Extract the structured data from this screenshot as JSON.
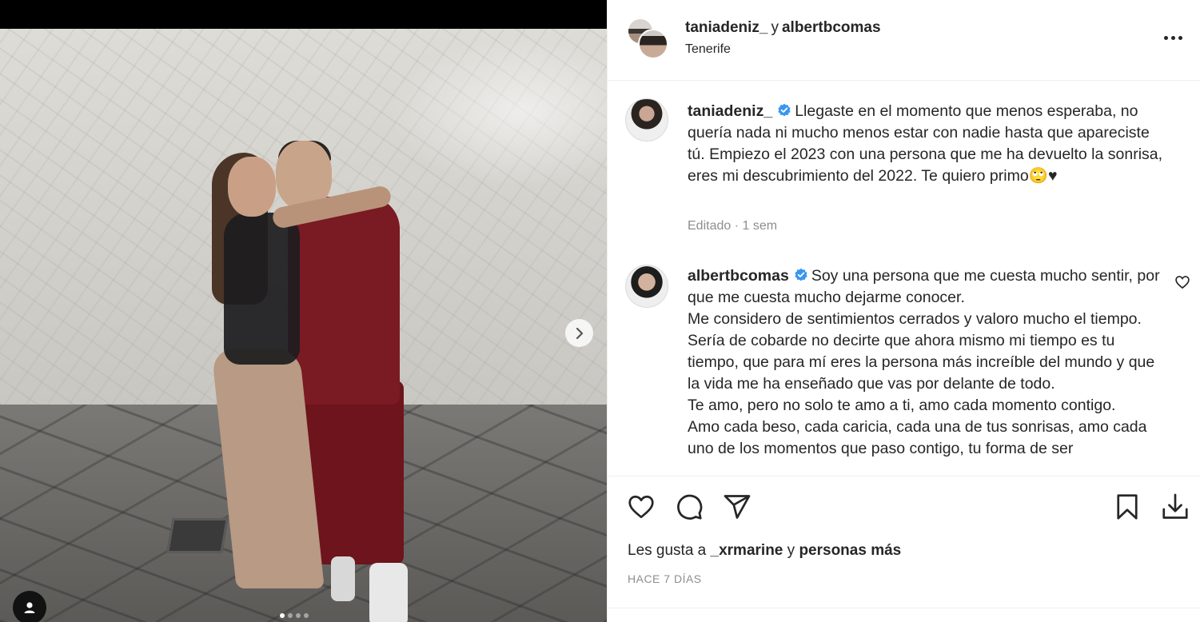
{
  "post": {
    "author_primary": "taniadeniz_",
    "joiner": "y",
    "author_secondary": "albertbcomas",
    "location": "Tenerife"
  },
  "caption": {
    "username": "taniadeniz_",
    "text": "Llegaste en el momento que menos esperaba, no quería nada ni mucho menos estar con nadie hasta que apareciste tú. Empiezo el 2023 con una persona que me ha devuelto la sonrisa, eres mi descubrimiento del 2022. Te quiero primo🙄♥",
    "meta": "Editado · 1 sem"
  },
  "comment": {
    "username": "albertbcomas",
    "text": "Soy una persona que me cuesta mucho sentir, por que me cuesta mucho dejarme conocer.\nMe considero de sentimientos cerrados y valoro mucho el tiempo.\nSería de cobarde no decirte que ahora mismo mi tiempo es tu tiempo, que para mí eres la persona más increíble del mundo y que la vida me ha enseñado que vas por delante de todo.\nTe amo, pero no solo te amo a ti, amo cada momento contigo.\nAmo cada beso, cada caricia, cada una de tus sonrisas, amo cada uno de los momentos que paso contigo, tu forma de ser"
  },
  "likes": {
    "prefix": "Les gusta a",
    "user": "_xrmarine",
    "joiner": "y",
    "others": "personas más"
  },
  "timestamp": "HACE 7 DÍAS",
  "carousel": {
    "count": 4,
    "active": 0
  },
  "icons": {
    "more": "more-options-icon",
    "verified": "verified-badge-icon",
    "heart": "heart-icon",
    "comment": "comment-icon",
    "share": "share-icon",
    "save": "bookmark-icon",
    "download": "download-icon",
    "next": "chevron-right-icon",
    "user_tag": "user-tag-icon"
  },
  "colors": {
    "verified": "#3897f0",
    "text": "#262626",
    "muted": "#8e8e8e"
  }
}
